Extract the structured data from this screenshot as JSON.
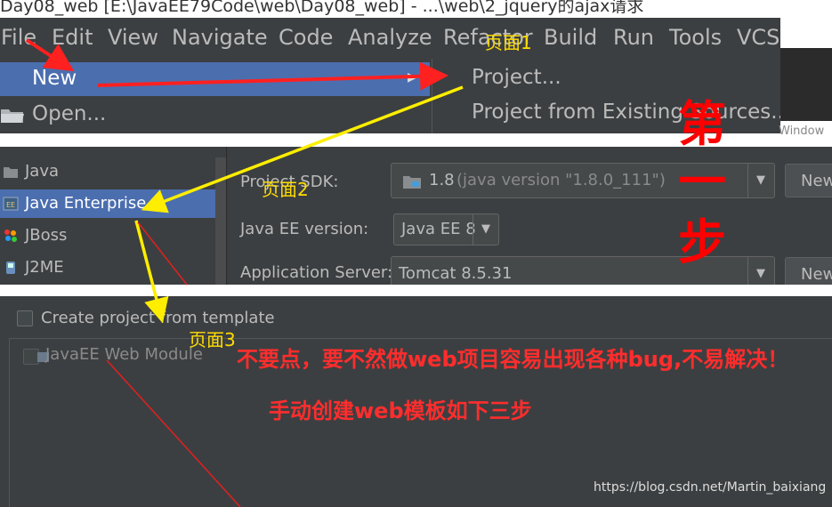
{
  "window": {
    "title": "Day08_web [E:\\JavaEE79Code\\web\\Day08_web] - ...\\web\\2_jquery的ajax请求"
  },
  "menubar": [
    "File",
    "Edit",
    "View",
    "Navigate",
    "Code",
    "Analyze",
    "Refactor",
    "Build",
    "Run",
    "Tools",
    "VCS"
  ],
  "file_menu": {
    "items": [
      "New",
      "Open..."
    ]
  },
  "new_submenu": {
    "items": [
      "Project...",
      "Project from Existing Sources..."
    ]
  },
  "side_label": "Window",
  "project_types": [
    "Java",
    "Java Enterprise",
    "JBoss",
    "J2ME"
  ],
  "project_types_selected": "Java Enterprise",
  "form": {
    "sdk_label": "Project SDK:",
    "sdk_value": "1.8",
    "sdk_detail": "(java version \"1.8.0_111\")",
    "javaee_label": "Java EE version:",
    "javaee_value": "Java EE 8",
    "appserver_label": "Application Server:",
    "appserver_value": "Tomcat 8.5.31",
    "new_button": "New..."
  },
  "template": {
    "checkbox_label": "Create project from template",
    "module_label": "JavaEE Web Module"
  },
  "annotations": {
    "page1": "页面1",
    "page2": "页面2",
    "page3": "页面3",
    "step_chars": [
      "第",
      "一",
      "步"
    ],
    "warning": "不要点，要不然做web项目容易出现各种bug,不易解决！",
    "instruction": "手动创建web模板如下三步",
    "watermark": "https://blog.csdn.net/Martin_baixiang"
  },
  "colors": {
    "ide_background": "#3c3f41",
    "selection": "#4b6eaf",
    "annotation_red": "#ff2d2d",
    "annotation_yellow": "#ffdd00"
  }
}
